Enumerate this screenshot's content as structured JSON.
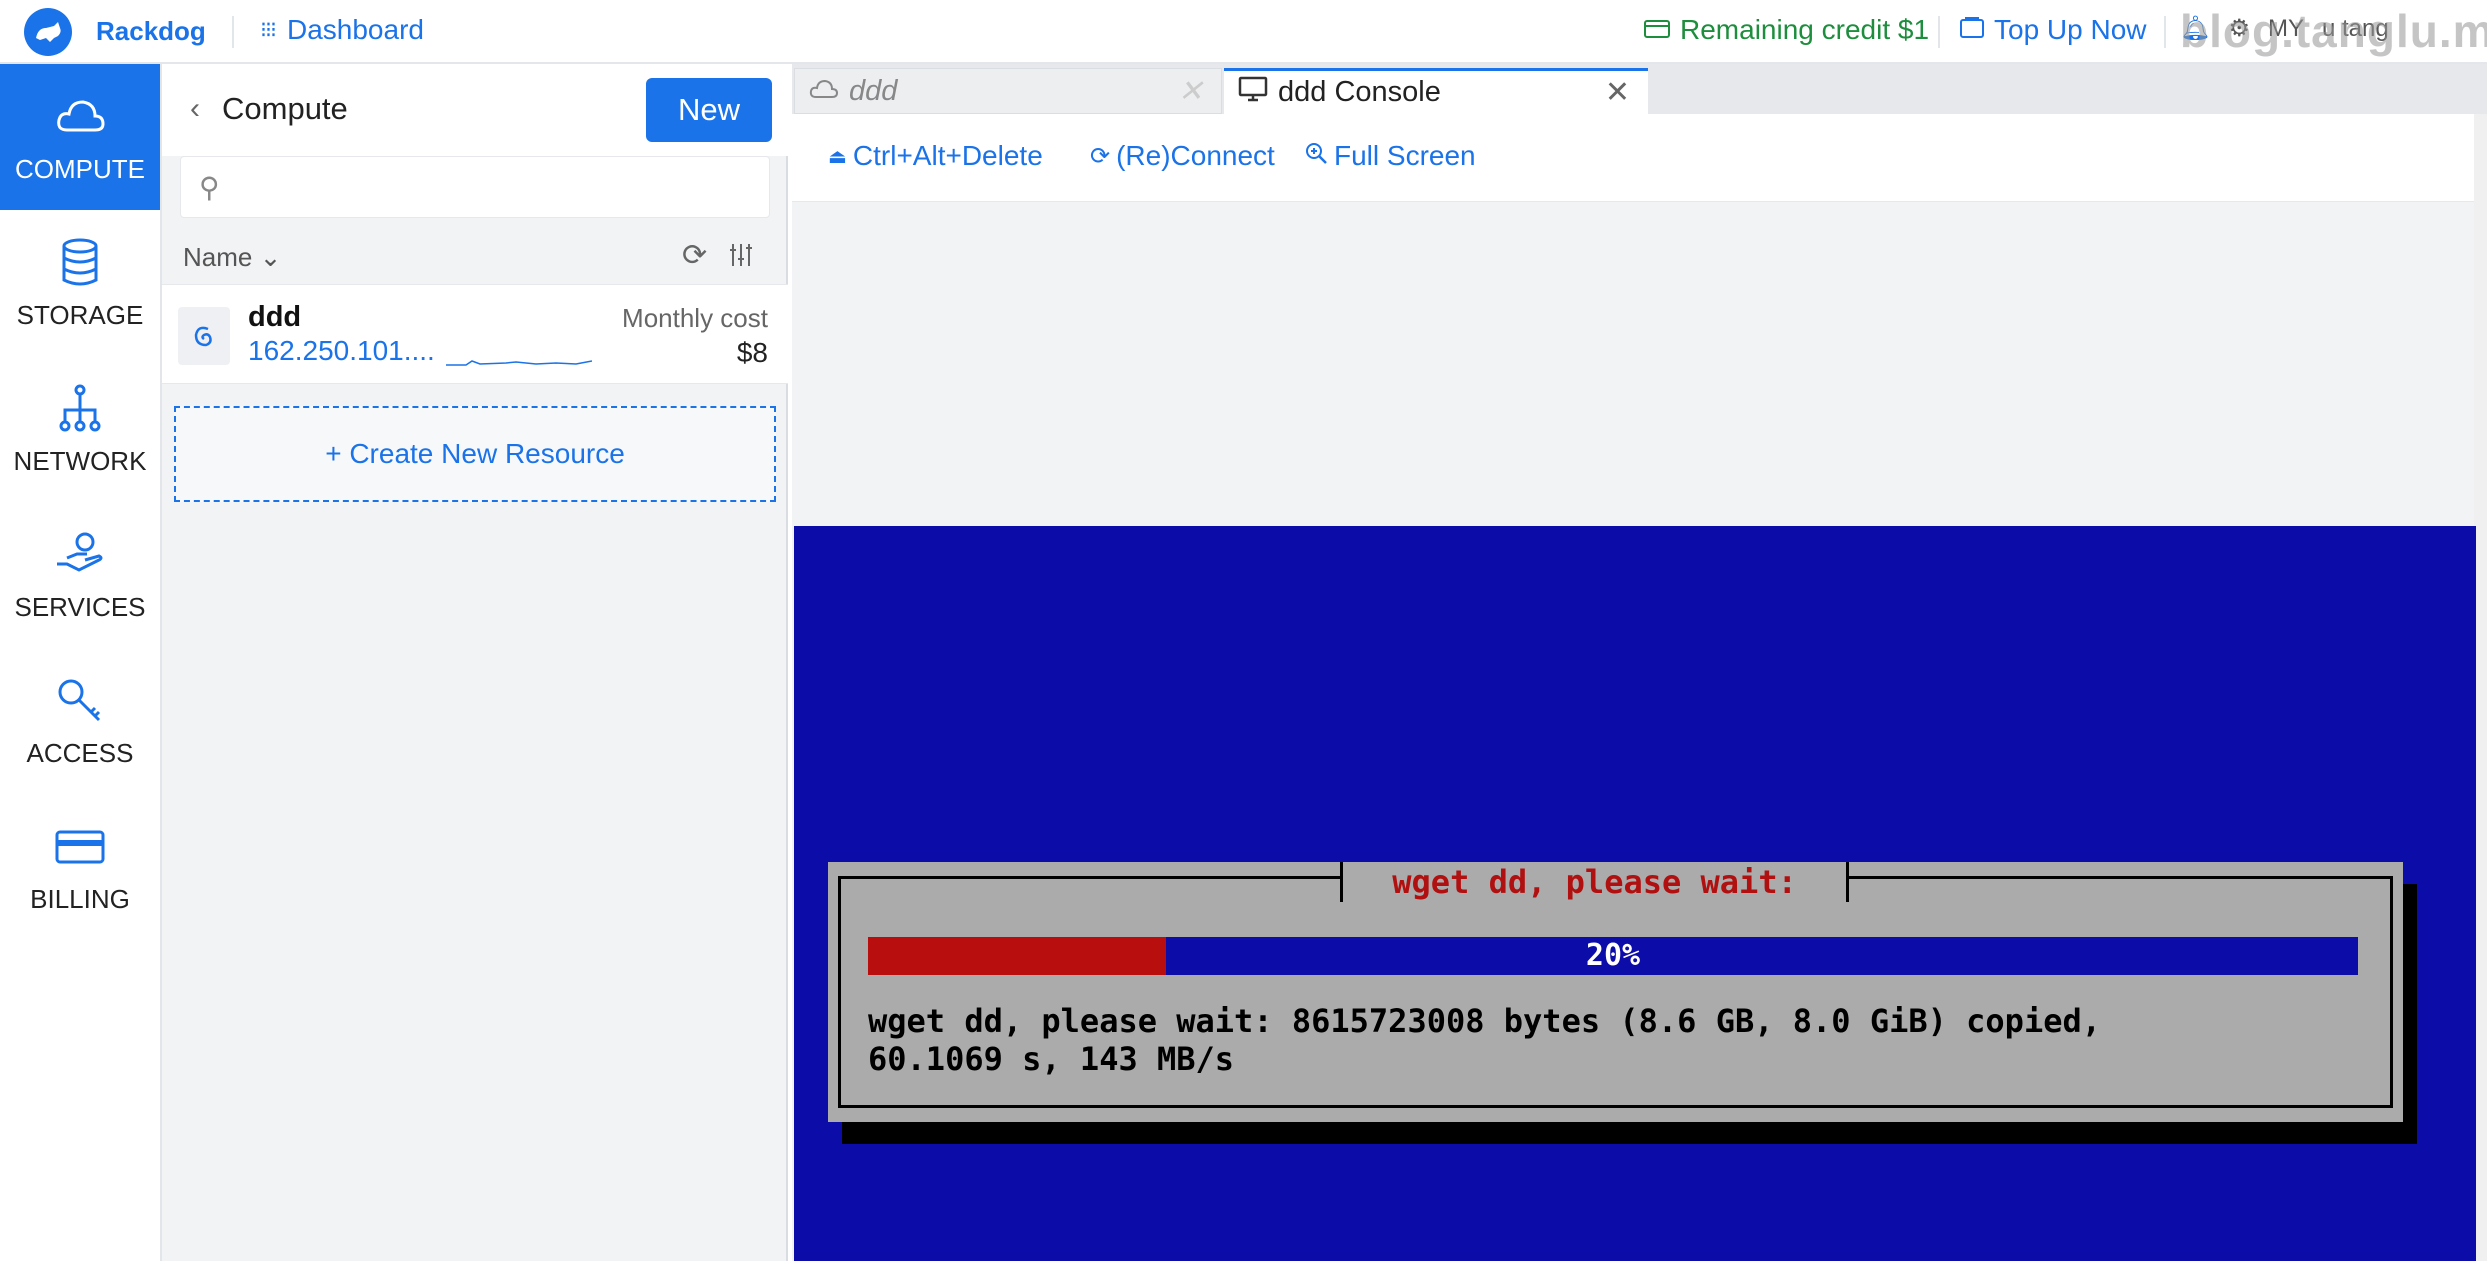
{
  "header": {
    "brand": "Rackdog",
    "dashboard_label": "Dashboard",
    "credit_label": "Remaining credit $1",
    "topup_label": "Top Up Now",
    "region": "MY",
    "user": "u tang",
    "watermark": "blog.tanglu.me"
  },
  "nav": {
    "items": [
      {
        "label": "COMPUTE",
        "icon": "cloud-icon",
        "active": true
      },
      {
        "label": "STORAGE",
        "icon": "database-icon"
      },
      {
        "label": "NETWORK",
        "icon": "network-icon"
      },
      {
        "label": "SERVICES",
        "icon": "services-icon"
      },
      {
        "label": "ACCESS",
        "icon": "key-icon"
      },
      {
        "label": "BILLING",
        "icon": "card-icon"
      }
    ]
  },
  "panel": {
    "title": "Compute",
    "new_label": "New",
    "search_placeholder": "",
    "column_name": "Name",
    "resources": [
      {
        "name": "ddd",
        "ip": "162.250.101....",
        "cost_label": "Monthly cost",
        "cost": "$8"
      }
    ],
    "create_label": "+ Create New Resource"
  },
  "tabs": [
    {
      "label": "ddd",
      "icon": "cloud-icon",
      "active": false
    },
    {
      "label": "ddd Console",
      "icon": "monitor-icon",
      "active": true
    }
  ],
  "toolbar": {
    "ctrl_alt_del": "Ctrl+Alt+Delete",
    "reconnect": "(Re)Connect",
    "fullscreen": "Full Screen"
  },
  "console": {
    "dialog_title": " wget dd, please wait: ",
    "progress_text": "20%",
    "progress": 0.2,
    "message": "wget dd, please wait: 8615723008 bytes (8.6 GB, 8.0 GiB) copied,\n60.1069 s, 143 MB/s",
    "colors": {
      "background": "#0c0ca8",
      "dialog": "#ababab",
      "progress_fill": "#b80e0e",
      "title": "#b01010"
    }
  },
  "colors": {
    "accent": "#1a73e8",
    "credit": "#1e8e3e"
  }
}
